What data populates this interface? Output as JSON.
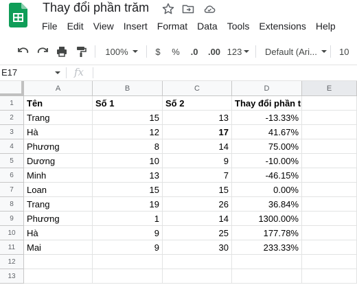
{
  "document": {
    "title": "Thay đổi phần trăm"
  },
  "menu": [
    "File",
    "Edit",
    "View",
    "Insert",
    "Format",
    "Data",
    "Tools",
    "Extensions",
    "Help"
  ],
  "toolbar": {
    "zoom": "100%",
    "currency": "$",
    "percent": "%",
    "decrease_decimal": ".0",
    "increase_decimal": ".00",
    "more_formats": "123",
    "font": "Default (Ari...",
    "font_size": "10"
  },
  "formula_bar": {
    "name_box": "E17",
    "fx": "fx",
    "value": ""
  },
  "colors": {
    "sheets_green": "#0f9d58",
    "header_bg": "#f8f9fa",
    "gridline": "#e2e3e3"
  },
  "grid": {
    "columns": [
      "A",
      "B",
      "C",
      "D",
      "E"
    ],
    "row_numbers": [
      "1",
      "2",
      "3",
      "4",
      "5",
      "6",
      "7",
      "8",
      "9",
      "10",
      "11",
      "12",
      "13"
    ],
    "header_row": [
      "Tên",
      "Số 1",
      "Số 2",
      "Thay đổi phần trăm"
    ],
    "rows": [
      [
        "Trang",
        "15",
        "13",
        "-13.33%"
      ],
      [
        "Hà",
        "12",
        "17",
        "41.67%"
      ],
      [
        "Phương",
        "8",
        "14",
        "75.00%"
      ],
      [
        "Dương",
        "10",
        "9",
        "-10.00%"
      ],
      [
        "Minh",
        "13",
        "7",
        "-46.15%"
      ],
      [
        "Loan",
        "15",
        "15",
        "0.00%"
      ],
      [
        "Trang",
        "19",
        "26",
        "36.84%"
      ],
      [
        "Phương",
        "1",
        "14",
        "1300.00%"
      ],
      [
        "Hà",
        "9",
        "25",
        "177.78%"
      ],
      [
        "Mai",
        "9",
        "30",
        "233.33%"
      ]
    ]
  }
}
